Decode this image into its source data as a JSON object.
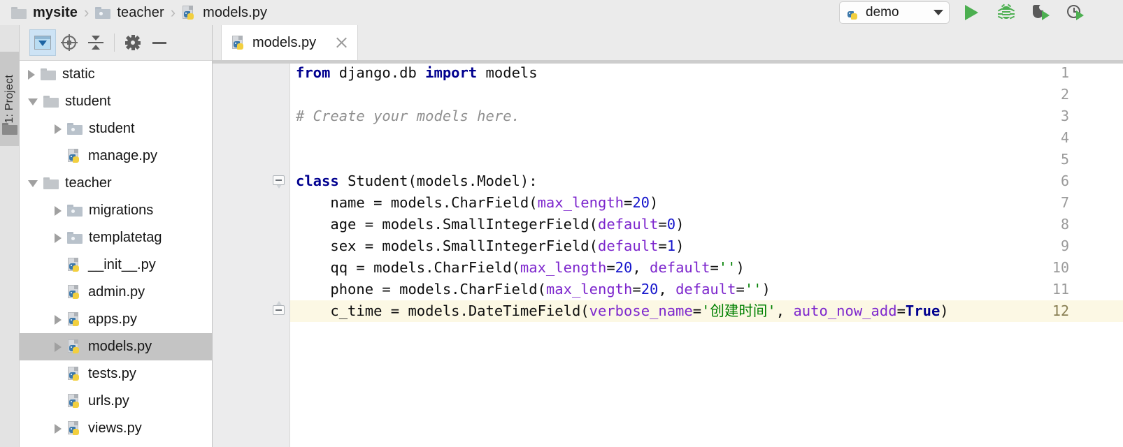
{
  "breadcrumb": {
    "items": [
      {
        "label": "mysite",
        "icon": "folder-icon",
        "bold": true
      },
      {
        "label": "teacher",
        "icon": "package-folder-icon",
        "bold": false
      },
      {
        "label": "models.py",
        "icon": "python-file-icon",
        "bold": false
      }
    ],
    "separator": "›"
  },
  "run_toolbar": {
    "config_name": "demo",
    "config_icon": "python-icon",
    "dropdown_icon": "chevron-down-icon",
    "buttons": [
      {
        "name": "run-button",
        "icon": "run-icon"
      },
      {
        "name": "debug-button",
        "icon": "bug-icon"
      },
      {
        "name": "run-with-coverage-button",
        "icon": "coverage-icon"
      },
      {
        "name": "profile-button",
        "icon": "profile-icon"
      }
    ]
  },
  "left_rail": {
    "tool_window_label": "1: Project",
    "tool_window_icon": "folder-icon"
  },
  "project_panel": {
    "toolbar": [
      {
        "name": "expand-all-button",
        "icon": "expand-all-icon",
        "selected": true
      },
      {
        "name": "select-opened-file-button",
        "icon": "crosshair-target-icon",
        "selected": false
      },
      {
        "name": "collapse-all-button",
        "icon": "collapse-all-icon",
        "selected": false
      },
      {
        "name": "settings-button",
        "icon": "gear-icon",
        "selected": false
      },
      {
        "name": "hide-panel-button",
        "icon": "minus-icon",
        "selected": false
      }
    ],
    "tree": [
      {
        "label": "static",
        "icon": "folder-icon",
        "arrow": "closed",
        "indent": 0,
        "selected": false
      },
      {
        "label": "student",
        "icon": "folder-icon",
        "arrow": "open",
        "indent": 0,
        "selected": false
      },
      {
        "label": "student",
        "icon": "package-folder-icon",
        "arrow": "closed",
        "indent": 1,
        "selected": false
      },
      {
        "label": "manage.py",
        "icon": "python-file-icon",
        "arrow": "none",
        "indent": 1,
        "selected": false
      },
      {
        "label": "teacher",
        "icon": "folder-icon",
        "arrow": "open",
        "indent": 0,
        "selected": false
      },
      {
        "label": "migrations",
        "icon": "package-folder-icon",
        "arrow": "closed",
        "indent": 1,
        "selected": false
      },
      {
        "label": "templatetag",
        "icon": "package-folder-icon",
        "arrow": "closed",
        "indent": 1,
        "selected": false
      },
      {
        "label": "__init__.py",
        "icon": "python-file-icon",
        "arrow": "none",
        "indent": 1,
        "selected": false
      },
      {
        "label": "admin.py",
        "icon": "python-file-icon",
        "arrow": "none",
        "indent": 1,
        "selected": false
      },
      {
        "label": "apps.py",
        "icon": "python-file-icon",
        "arrow": "closed",
        "indent": 1,
        "selected": false
      },
      {
        "label": "models.py",
        "icon": "python-file-icon",
        "arrow": "closed",
        "indent": 1,
        "selected": true
      },
      {
        "label": "tests.py",
        "icon": "python-file-icon",
        "arrow": "none",
        "indent": 1,
        "selected": false
      },
      {
        "label": "urls.py",
        "icon": "python-file-icon",
        "arrow": "none",
        "indent": 1,
        "selected": false
      },
      {
        "label": "views.py",
        "icon": "python-file-icon",
        "arrow": "closed",
        "indent": 1,
        "selected": false
      }
    ]
  },
  "editor": {
    "tabs": [
      {
        "label": "models.py",
        "icon": "python-file-icon",
        "active": true,
        "close_icon": "close-icon"
      }
    ],
    "caret_line": 12,
    "line_numbers": [
      1,
      2,
      3,
      4,
      5,
      6,
      7,
      8,
      9,
      10,
      11,
      12
    ],
    "fold_markers": [
      {
        "line": 6,
        "type": "fold-start-icon"
      },
      {
        "line": 12,
        "type": "fold-end-icon"
      }
    ],
    "code_lines": [
      {
        "n": 1,
        "tokens": [
          {
            "t": "from ",
            "c": "kw"
          },
          {
            "t": "django.db ",
            "c": "plain"
          },
          {
            "t": "import ",
            "c": "kw"
          },
          {
            "t": "models",
            "c": "plain"
          }
        ]
      },
      {
        "n": 2,
        "tokens": []
      },
      {
        "n": 3,
        "tokens": [
          {
            "t": "# Create your models here.",
            "c": "cmt"
          }
        ]
      },
      {
        "n": 4,
        "tokens": []
      },
      {
        "n": 5,
        "tokens": []
      },
      {
        "n": 6,
        "tokens": [
          {
            "t": "class ",
            "c": "kw"
          },
          {
            "t": "Student(models.Model):",
            "c": "plain"
          }
        ]
      },
      {
        "n": 7,
        "tokens": [
          {
            "t": "    name = models.CharField(",
            "c": "plain"
          },
          {
            "t": "max_length",
            "c": "kwarg"
          },
          {
            "t": "=",
            "c": "plain"
          },
          {
            "t": "20",
            "c": "num"
          },
          {
            "t": ")",
            "c": "plain"
          }
        ]
      },
      {
        "n": 8,
        "tokens": [
          {
            "t": "    age = models.SmallIntegerField(",
            "c": "plain"
          },
          {
            "t": "default",
            "c": "kwarg"
          },
          {
            "t": "=",
            "c": "plain"
          },
          {
            "t": "0",
            "c": "num"
          },
          {
            "t": ")",
            "c": "plain"
          }
        ]
      },
      {
        "n": 9,
        "tokens": [
          {
            "t": "    sex = models.SmallIntegerField(",
            "c": "plain"
          },
          {
            "t": "default",
            "c": "kwarg"
          },
          {
            "t": "=",
            "c": "plain"
          },
          {
            "t": "1",
            "c": "num"
          },
          {
            "t": ")",
            "c": "plain"
          }
        ]
      },
      {
        "n": 10,
        "tokens": [
          {
            "t": "    qq = models.CharField(",
            "c": "plain"
          },
          {
            "t": "max_length",
            "c": "kwarg"
          },
          {
            "t": "=",
            "c": "plain"
          },
          {
            "t": "20",
            "c": "num"
          },
          {
            "t": ", ",
            "c": "plain"
          },
          {
            "t": "default",
            "c": "kwarg"
          },
          {
            "t": "=",
            "c": "plain"
          },
          {
            "t": "''",
            "c": "str"
          },
          {
            "t": ")",
            "c": "plain"
          }
        ]
      },
      {
        "n": 11,
        "tokens": [
          {
            "t": "    phone = models.CharField(",
            "c": "plain"
          },
          {
            "t": "max_length",
            "c": "kwarg"
          },
          {
            "t": "=",
            "c": "plain"
          },
          {
            "t": "20",
            "c": "num"
          },
          {
            "t": ", ",
            "c": "plain"
          },
          {
            "t": "default",
            "c": "kwarg"
          },
          {
            "t": "=",
            "c": "plain"
          },
          {
            "t": "''",
            "c": "str"
          },
          {
            "t": ")",
            "c": "plain"
          }
        ]
      },
      {
        "n": 12,
        "tokens": [
          {
            "t": "    c_time = models.DateTimeField(",
            "c": "plain"
          },
          {
            "t": "verbose_name",
            "c": "kwarg"
          },
          {
            "t": "=",
            "c": "plain"
          },
          {
            "t": "'创建时间'",
            "c": "str"
          },
          {
            "t": ", ",
            "c": "plain"
          },
          {
            "t": "auto_now_add",
            "c": "kwarg"
          },
          {
            "t": "=",
            "c": "plain"
          },
          {
            "t": "True",
            "c": "kw"
          },
          {
            "t": ")",
            "c": "plain"
          }
        ]
      }
    ]
  },
  "colors": {
    "keyword": "#00008f",
    "comment": "#909090",
    "kwarg": "#7d26cd",
    "number": "#1414cc",
    "string": "#008000",
    "caret_line_bg": "#fcf8e4",
    "selection_bg": "#c4c4c4",
    "chrome_bg": "#ebebeb",
    "run_green": "#4caf50"
  }
}
